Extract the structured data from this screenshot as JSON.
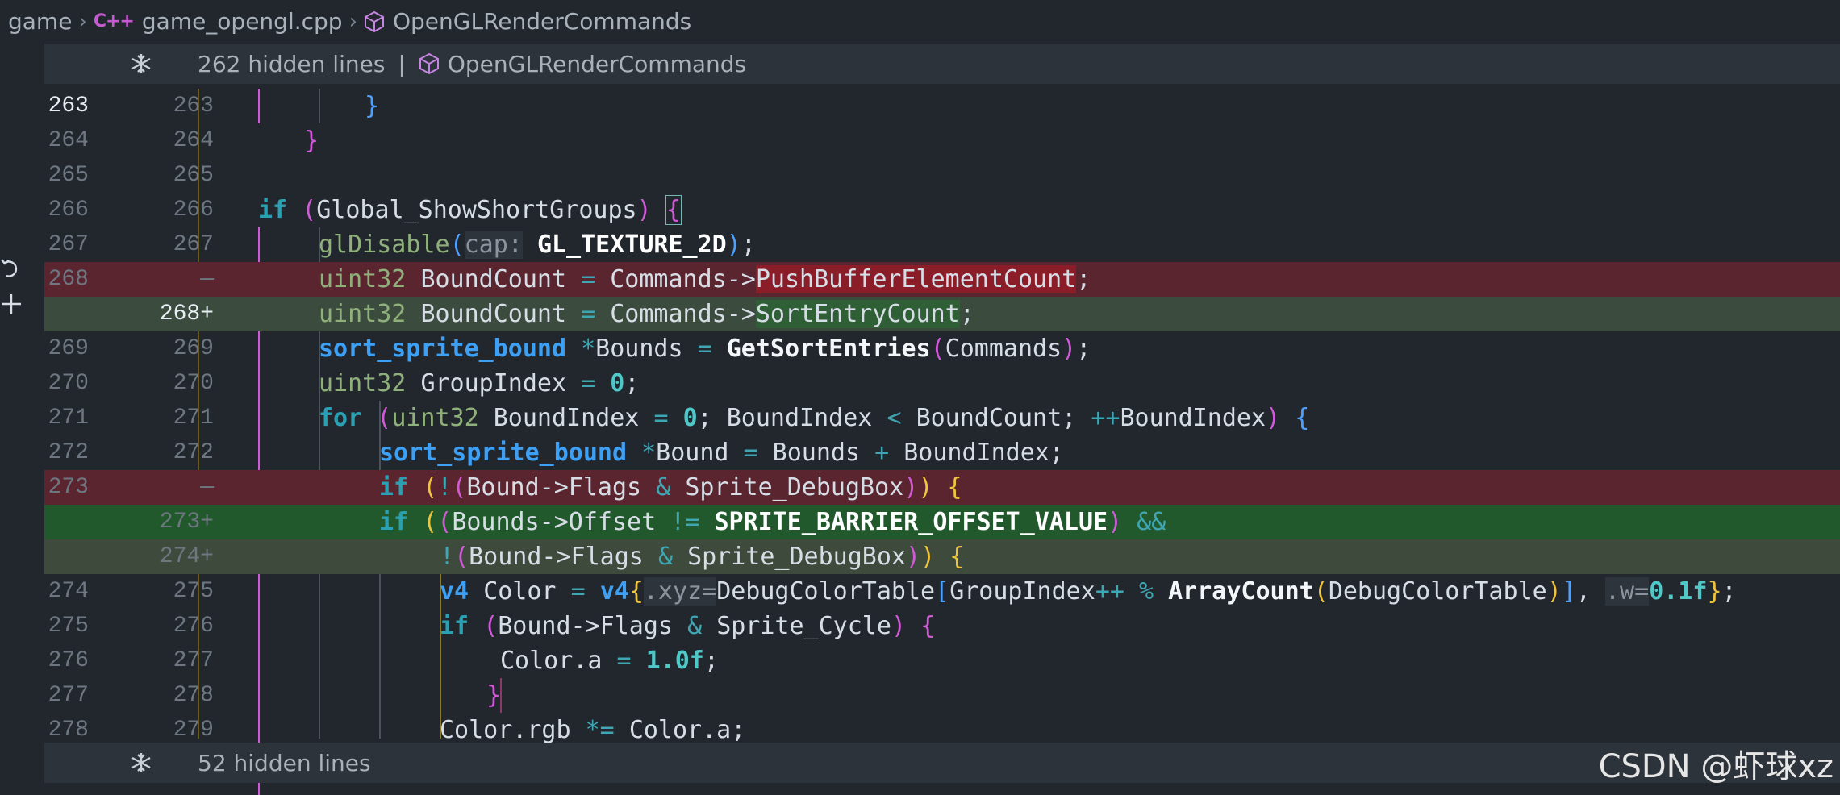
{
  "breadcrumb": {
    "items": [
      "game",
      "game_opengl.cpp",
      "OpenGLRenderCommands"
    ],
    "file_icon_text": "C++"
  },
  "fold_top": {
    "hidden_text": "262 hidden lines",
    "separator": "|",
    "symbol": "OpenGLRenderCommands"
  },
  "fold_bottom": {
    "hidden_text": "52 hidden lines"
  },
  "lines": [
    {
      "old": "263",
      "new": "263",
      "kind": "ctx"
    },
    {
      "old": "264",
      "new": "264",
      "kind": "ctx"
    },
    {
      "old": "265",
      "new": "265",
      "kind": "ctx"
    },
    {
      "old": "266",
      "new": "266",
      "kind": "ctx"
    },
    {
      "old": "267",
      "new": "267",
      "kind": "ctx"
    },
    {
      "old": "268",
      "new": "—",
      "kind": "del"
    },
    {
      "old": "",
      "new": "268+",
      "kind": "add"
    },
    {
      "old": "269",
      "new": "269",
      "kind": "ctx"
    },
    {
      "old": "270",
      "new": "270",
      "kind": "ctx"
    },
    {
      "old": "271",
      "new": "271",
      "kind": "ctx"
    },
    {
      "old": "272",
      "new": "272",
      "kind": "ctx"
    },
    {
      "old": "273",
      "new": "—",
      "kind": "del"
    },
    {
      "old": "",
      "new": "273+",
      "kind": "add"
    },
    {
      "old": "",
      "new": "274+",
      "kind": "add"
    },
    {
      "old": "274",
      "new": "275",
      "kind": "ctx"
    },
    {
      "old": "275",
      "new": "276",
      "kind": "ctx"
    },
    {
      "old": "276",
      "new": "277",
      "kind": "ctx"
    },
    {
      "old": "277",
      "new": "278",
      "kind": "ctx"
    },
    {
      "old": "278",
      "new": "279",
      "kind": "ctx"
    }
  ],
  "code": {
    "l263": "}",
    "l264": "}",
    "l266_if": "if",
    "l266_cond": "Global_ShowShortGroups",
    "l267_fn": "glDisable",
    "l267_hint": "cap:",
    "l267_arg": "GL_TEXTURE_2D",
    "l268_type": "uint32",
    "l268_var": "BoundCount",
    "l268_obj": "Commands->",
    "l268_old_field": "PushBufferElementCount",
    "l268_new_field": "SortEntryCount",
    "l269_type": "sort_sprite_bound",
    "l269_var": "Bounds",
    "l269_fn": "GetSortEntries",
    "l269_arg": "Commands",
    "l270_type": "uint32",
    "l270_var": "GroupIndex",
    "l270_val": "0",
    "l271_for": "for",
    "l271_type": "uint32",
    "l271_var": "BoundIndex",
    "l271_val": "0",
    "l271_cmp": "BoundIndex",
    "l271_lim": "BoundCount",
    "l271_inc": "BoundIndex",
    "l272_type": "sort_sprite_bound",
    "l272_var": "Bound",
    "l272_rhs": "Bounds",
    "l272_idx": "BoundIndex",
    "l273_if": "if",
    "l273_expr": "Bound->Flags",
    "l273_flag": "Sprite_DebugBox",
    "l273n_if": "if",
    "l273n_lhs": "Bounds->Offset",
    "l273n_macro": "SPRITE_BARRIER_OFFSET_VALUE",
    "l274n_expr": "Bound->Flags",
    "l274n_flag": "Sprite_DebugBox",
    "l275_type": "v4",
    "l275_var": "Color",
    "l275_ctor": "v4",
    "l275_hint1": ".xyz=",
    "l275_table": "DebugColorTable",
    "l275_idx": "GroupIndex",
    "l275_fn": "ArrayCount",
    "l275_arg": "DebugColorTable",
    "l275_hint2": ".w=",
    "l275_val": "0.1f",
    "l276_if": "if",
    "l276_expr": "Bound->Flags",
    "l276_flag": "Sprite_Cycle",
    "l277_lhs": "Color.a",
    "l277_val": "1.0f",
    "l279_lhs": "Color.rgb",
    "l279_rhs": "Color.a"
  },
  "watermark": "CSDN @虾球xz",
  "colors": {
    "deleted_bg": "#5b2530",
    "added_bg": "#3b4b3e",
    "keyword": "#2aa1b3",
    "type": "#3ea0f4"
  }
}
